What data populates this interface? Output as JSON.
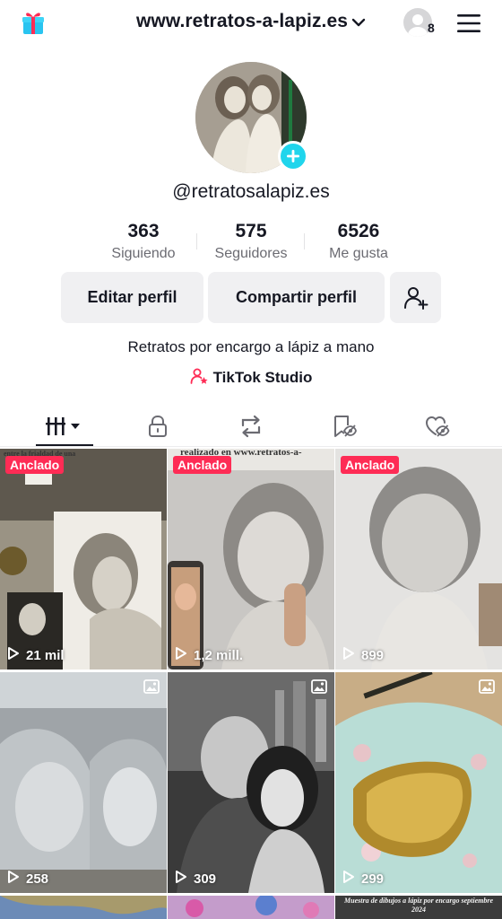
{
  "header": {
    "title": "www.retratos-a-lapiz.es",
    "account_count": "8"
  },
  "profile": {
    "username": "@retratosalapiz.es",
    "bio": "Retratos por encargo a lápiz a mano",
    "studio_label": "TikTok Studio"
  },
  "stats": [
    {
      "value": "363",
      "label": "Siguiendo"
    },
    {
      "value": "575",
      "label": "Seguidores"
    },
    {
      "value": "6526",
      "label": "Me gusta"
    }
  ],
  "actions": {
    "edit_label": "Editar perfil",
    "share_label": "Compartir perfil"
  },
  "tabs": [
    "videos-grid-icon",
    "lock-icon",
    "repost-icon",
    "saved-icon",
    "liked-icon"
  ],
  "videos": [
    {
      "pinned": "Anclado",
      "views": "21 mil",
      "caption": "entre la frialdad de una"
    },
    {
      "pinned": "Anclado",
      "views": "1,2 mill.",
      "caption": "realizado en www.retratos-a-lapiz.es"
    },
    {
      "pinned": "Anclado",
      "views": "899",
      "caption": ""
    },
    {
      "pinned": "",
      "views": "258",
      "caption": ""
    },
    {
      "pinned": "",
      "views": "309",
      "caption": ""
    },
    {
      "pinned": "",
      "views": "299",
      "caption": ""
    },
    {
      "pinned": "",
      "views": "",
      "caption": ""
    },
    {
      "pinned": "",
      "views": "",
      "caption": ""
    },
    {
      "pinned": "",
      "views": "",
      "caption": "Muestra de dibujos a lápiz por encargo septiembre 2024"
    }
  ],
  "colors": {
    "accent_red": "#fe2c55",
    "add_blue": "#20d5ec",
    "button_bg": "#f0f0f2",
    "text": "#161823"
  }
}
